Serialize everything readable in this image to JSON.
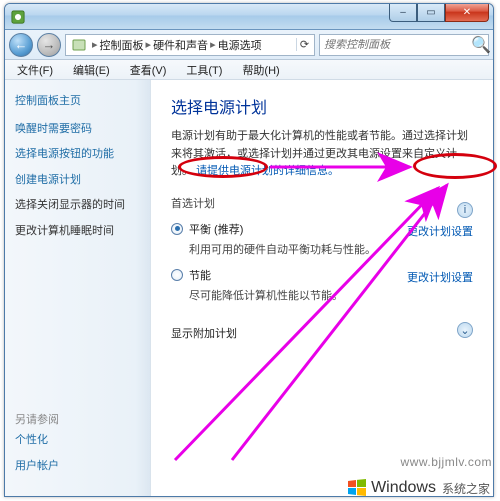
{
  "titlebar": {
    "min_glyph": "–",
    "max_glyph": "▭",
    "close_glyph": "✕"
  },
  "addrbar": {
    "back_glyph": "←",
    "fwd_glyph": "→",
    "segments": [
      "控制面板",
      "硬件和声音",
      "电源选项"
    ],
    "sep": "▸",
    "refresh_glyph": "⟳"
  },
  "search": {
    "placeholder": "搜索控制面板",
    "icon_glyph": "🔍"
  },
  "menu": {
    "items": [
      "文件(F)",
      "编辑(E)",
      "查看(V)",
      "工具(T)",
      "帮助(H)"
    ]
  },
  "sidebar": {
    "home": "控制面板主页",
    "links": [
      "唤醒时需要密码",
      "选择电源按钮的功能",
      "创建电源计划"
    ],
    "dark_links": [
      "选择关闭显示器的时间",
      "更改计算机睡眠时间"
    ],
    "bottom_heading": "另请参阅",
    "bottom_links": [
      "个性化",
      "用户帐户"
    ]
  },
  "main": {
    "heading": "选择电源计划",
    "paragraph_a": "电源计划有助于最大化计算机的性能或者节能。通过选择计划来将其激活，或选择计划并通过更改其电源设置来自定义计划。",
    "paragraph_link": "请提供电源计划的详细信息。",
    "preferred": "首选计划",
    "plan1": {
      "title": "平衡 (推荐)",
      "desc": "利用可用的硬件自动平衡功耗与性能。",
      "edit": "更改计划设置"
    },
    "plan2": {
      "title": "节能",
      "desc": "尽可能降低计算机性能以节能。",
      "edit": "更改计划设置"
    },
    "show_more": "显示附加计划",
    "info_glyph": "i",
    "expand_glyph": "⌄"
  },
  "watermark": "www.bjjmlv.com",
  "brand": {
    "text": "Windows",
    "sub": "系统之家"
  },
  "colors": {
    "link": "#1f6da6",
    "heading": "#003399",
    "accent_red": "#d4000d",
    "arrow": "#e800e8"
  }
}
